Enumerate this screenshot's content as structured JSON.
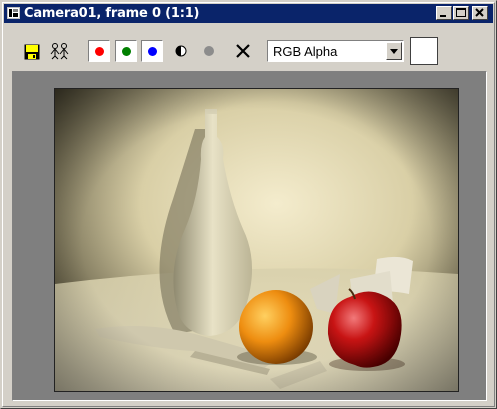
{
  "window": {
    "title": "Camera01, frame 0 (1:1)",
    "titlebar_color": "#0a246a",
    "controls": [
      "minimize",
      "maximize",
      "close"
    ]
  },
  "toolbar": {
    "tools": [
      "save-icon",
      "clone-icon"
    ],
    "channel_buttons": [
      {
        "name": "red",
        "color": "#ff0000"
      },
      {
        "name": "green",
        "color": "#008000"
      },
      {
        "name": "blue",
        "color": "#0000ff"
      }
    ],
    "icons": [
      "monochrome-icon",
      "alpha-icon",
      "clear-icon"
    ],
    "channel_select": {
      "value": "RGB Alpha"
    },
    "swatch_color": "#ffffff"
  },
  "render": {
    "subjects": [
      "bottle",
      "orange",
      "apple",
      "paper-scraps",
      "knife"
    ]
  }
}
